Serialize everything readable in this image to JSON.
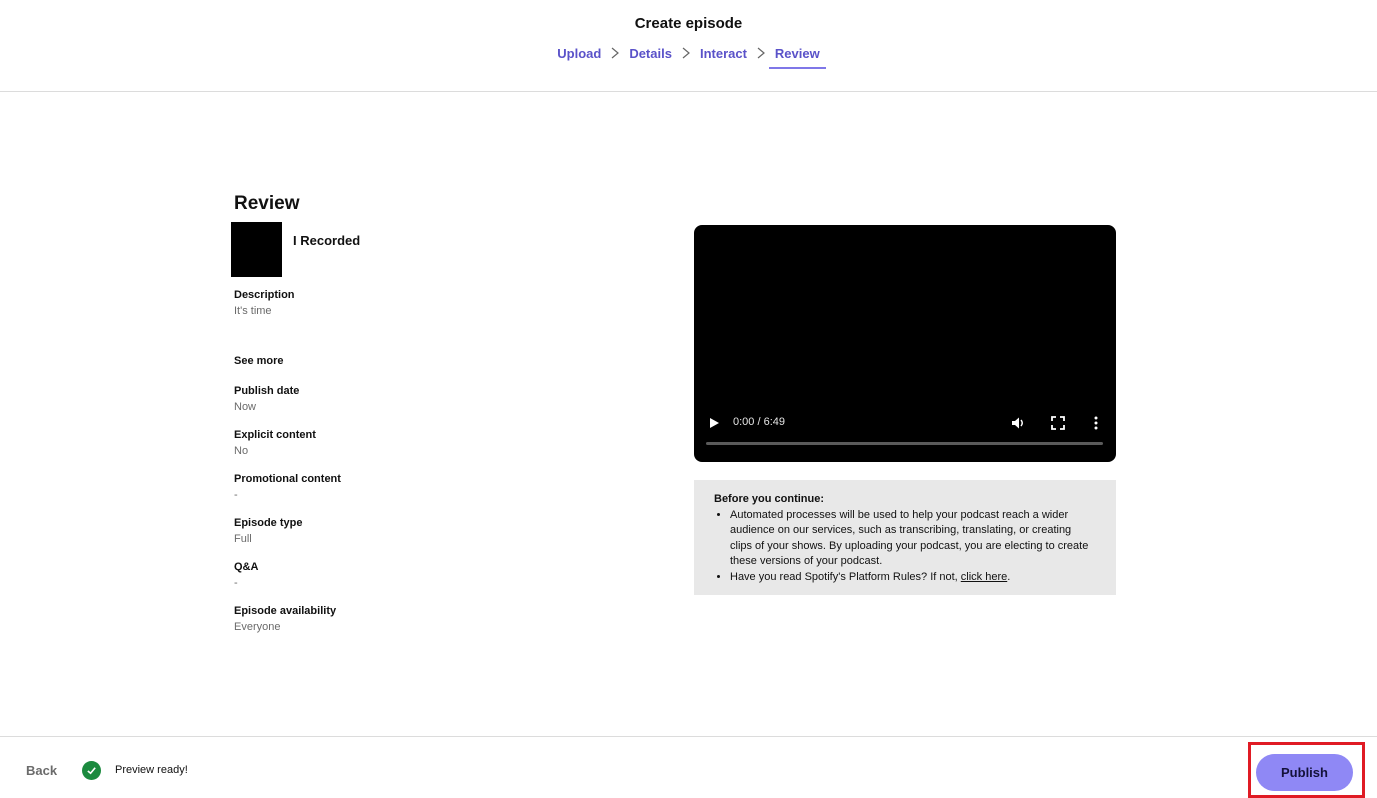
{
  "header": {
    "title": "Create episode",
    "steps": [
      {
        "label": "Upload",
        "active": false
      },
      {
        "label": "Details",
        "active": false
      },
      {
        "label": "Interact",
        "active": false
      },
      {
        "label": "Review",
        "active": true
      }
    ]
  },
  "review": {
    "heading": "Review",
    "episode_title": "I Recorded",
    "description_label": "Description",
    "description_value": "It's time",
    "see_more": "See more",
    "fields": [
      {
        "label": "Publish date",
        "value": "Now"
      },
      {
        "label": "Explicit content",
        "value": "No"
      },
      {
        "label": "Promotional content",
        "value": "-"
      },
      {
        "label": "Episode type",
        "value": "Full"
      },
      {
        "label": "Q&A",
        "value": "-"
      },
      {
        "label": "Episode availability",
        "value": "Everyone"
      }
    ]
  },
  "video": {
    "time": "0:00 / 6:49",
    "progress": 0,
    "icons": [
      "play-icon",
      "volume-icon",
      "fullscreen-icon",
      "more-options-icon"
    ]
  },
  "notice": {
    "title": "Before you continue:",
    "bullet1": "Automated processes will be used to help your podcast reach a wider audience on our services, such as transcribing, translating, or creating clips of your shows. By uploading your podcast, you are electing to create these versions of your podcast.",
    "bullet2_prefix": "Have you read Spotify's Platform Rules? If not, ",
    "bullet2_link": "click here",
    "bullet2_suffix": "."
  },
  "footer": {
    "back_label": "Back",
    "status_text": "Preview ready!",
    "publish_label": "Publish"
  },
  "colors": {
    "accent": "#5a52c9",
    "publish_button": "#8f88f5",
    "success": "#1b8a3e",
    "highlight_box": "#e01b24"
  }
}
